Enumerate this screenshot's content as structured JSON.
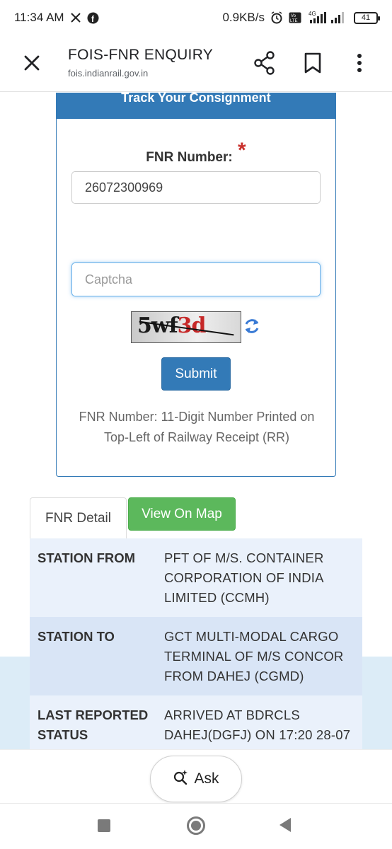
{
  "status_bar": {
    "time": "11:34 AM",
    "network_speed": "0.9KB/s",
    "network_type": "4G",
    "volte": "Vo LTE",
    "battery": "41",
    "icons": [
      "x-logo-icon",
      "facebook-icon",
      "alarm-icon",
      "volte-icon",
      "signal-icon",
      "battery-icon"
    ]
  },
  "app_bar": {
    "title": "FOIS-FNR ENQUIRY",
    "url": "fois.indianrail.gov.in",
    "icons": [
      "close-icon",
      "share-icon",
      "bookmark-icon",
      "more-vert-icon"
    ]
  },
  "track_form": {
    "header": "Track Your Consignment",
    "fnr_label": "FNR Number:",
    "required_marker": "*",
    "fnr_value": "26072300969",
    "captcha_placeholder": "Captcha",
    "captcha_text_black": "5wf",
    "captcha_text_red": "3d",
    "submit_label": "Submit",
    "help_text": "FNR Number: 11-Digit Number Printed on Top-Left of Railway Receipt (RR)"
  },
  "tabs": [
    {
      "label": "FNR Detail",
      "active": true
    },
    {
      "label": "View On Map",
      "active": false
    }
  ],
  "fnr_details": [
    {
      "key": "STATION FROM",
      "value": "PFT OF M/S. CONTAINER CORPORATION OF INDIA LIMITED (CCMH)"
    },
    {
      "key": "STATION TO",
      "value": "GCT MULTI-MODAL CARGO TERMINAL OF M/S CONCOR FROM DAHEJ (CGMD)"
    },
    {
      "key": "LAST REPORTED STATUS",
      "value": "ARRIVED AT BDRCLS DAHEJ(DGFJ) ON 17:20 28-07"
    }
  ],
  "ask": {
    "label": "Ask"
  },
  "colors": {
    "primary_blue": "#337ab7",
    "map_green": "#5cb85c",
    "required_red": "#c9302c",
    "row_light": "#eaf1fb",
    "row_dark": "#d9e5f6"
  }
}
